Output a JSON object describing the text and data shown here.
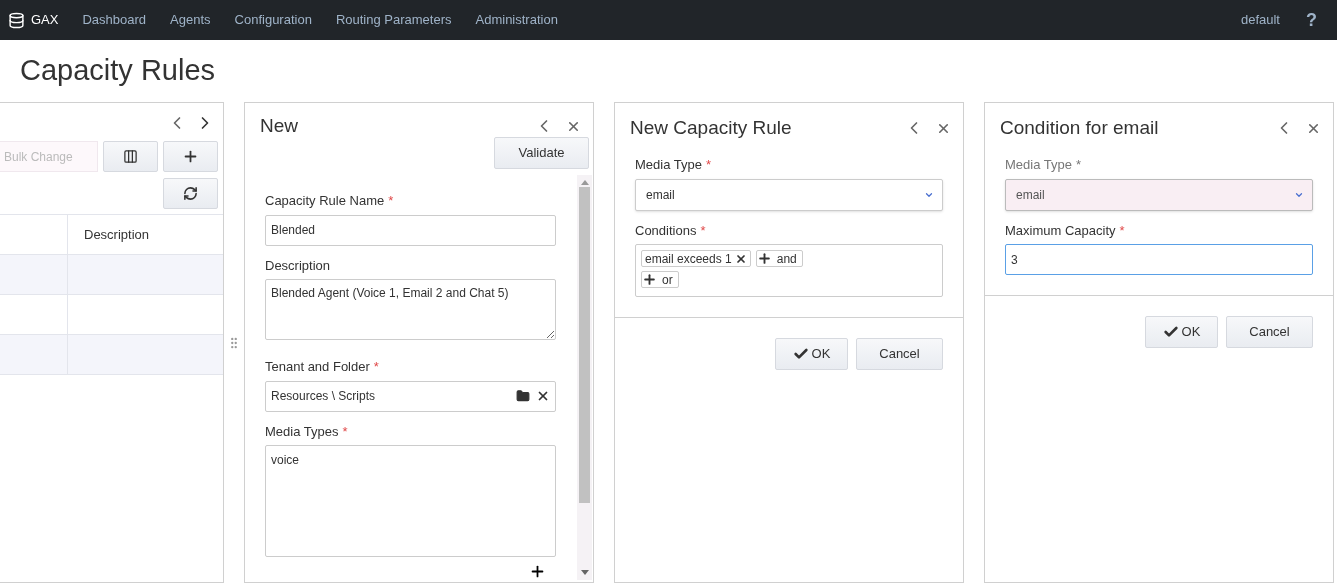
{
  "navbar": {
    "brand": "GAX",
    "items": [
      {
        "label": "Dashboard"
      },
      {
        "label": "Agents"
      },
      {
        "label": "Configuration"
      },
      {
        "label": "Routing Parameters"
      },
      {
        "label": "Administration"
      }
    ],
    "user": "default",
    "help": "?"
  },
  "page_title": "Capacity Rules",
  "list_panel": {
    "bulk_change": {
      "placeholder": "Bulk Change"
    },
    "table": {
      "columns": [
        {
          "label": "Description"
        }
      ]
    }
  },
  "editor_panel": {
    "title": "New",
    "validate": "Validate",
    "fields": [
      {
        "kind": "text",
        "label": "Capacity Rule Name",
        "required_mark": "*",
        "value": "Blended"
      },
      {
        "kind": "textarea",
        "label": "Description",
        "value": "Blended Agent (Voice 1, Email 2 and Chat 5)"
      },
      {
        "kind": "folder",
        "label": "Tenant and Folder",
        "required_mark": "*",
        "value": "Resources \\ Scripts"
      },
      {
        "kind": "list",
        "label": "Media Types",
        "required_mark": "*",
        "items": [
          "voice"
        ]
      }
    ]
  },
  "rule_panel": {
    "title": "New Capacity Rule",
    "fields": [
      {
        "kind": "select",
        "label": "Media Type",
        "required_mark": "*",
        "disabled": false,
        "value": "email"
      },
      {
        "kind": "conditions",
        "label": "Conditions",
        "required_mark": "*",
        "chips": [
          {
            "kind": "condition",
            "label": "email exceeds 1"
          },
          {
            "kind": "add",
            "label": "and"
          },
          {
            "kind": "add",
            "label": "or"
          }
        ]
      }
    ],
    "buttons": [
      {
        "kind": "ok",
        "label": "OK"
      },
      {
        "kind": "cancel",
        "label": "Cancel"
      }
    ]
  },
  "condition_panel": {
    "title": "Condition for email",
    "fields": [
      {
        "kind": "select",
        "label": "Media Type",
        "required_mark": "*",
        "disabled": true,
        "value": "email"
      },
      {
        "kind": "text",
        "label": "Maximum Capacity",
        "required_mark": "*",
        "focused": true,
        "value": "3"
      }
    ],
    "buttons": [
      {
        "kind": "ok",
        "label": "OK"
      },
      {
        "kind": "cancel",
        "label": "Cancel"
      }
    ]
  }
}
